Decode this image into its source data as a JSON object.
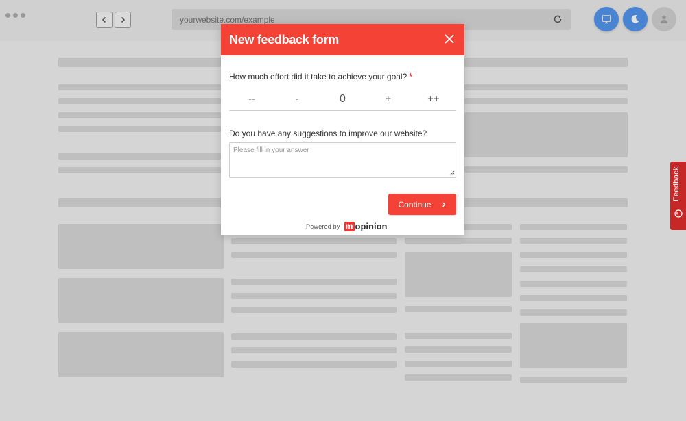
{
  "browser": {
    "url": "yourwebsite.com/example"
  },
  "modal": {
    "title": "New feedback form",
    "question1": "How much effort did it take to achieve your goal?",
    "required_marker": "*",
    "scale": [
      "--",
      "-",
      "0",
      "+",
      "++"
    ],
    "question2": "Do you have any suggestions to improve our website?",
    "answer_placeholder": "Please fill in your answer",
    "answer_value": "",
    "continue_label": "Continue",
    "powered_by": "Powered by",
    "brand_letter": "m",
    "brand_rest": "opinion"
  },
  "feedback_tab": {
    "label": "Feedback"
  },
  "icons": {
    "back": "chevron-left-icon",
    "forward": "chevron-right-icon",
    "reload": "reload-icon",
    "desktop": "monitor-icon",
    "dark_mode": "moon-icon",
    "user": "user-icon",
    "close": "close-icon",
    "feedback": "alert-circle-icon"
  },
  "colors": {
    "accent": "#f44336",
    "feedback_tab": "#c62828",
    "blue_buttons": "#2b7de9",
    "required": "#e53935"
  }
}
